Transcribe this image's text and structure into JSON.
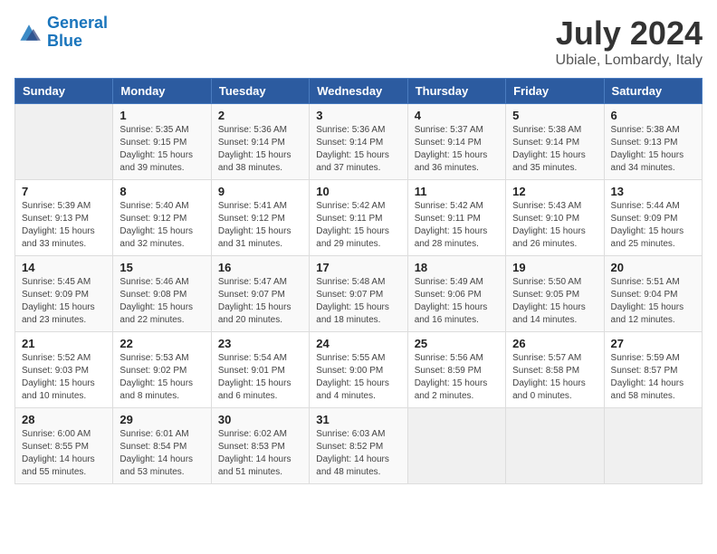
{
  "header": {
    "logo_line1": "General",
    "logo_line2": "Blue",
    "month_year": "July 2024",
    "location": "Ubiale, Lombardy, Italy"
  },
  "weekdays": [
    "Sunday",
    "Monday",
    "Tuesday",
    "Wednesday",
    "Thursday",
    "Friday",
    "Saturday"
  ],
  "weeks": [
    [
      {
        "day": "",
        "info": ""
      },
      {
        "day": "1",
        "info": "Sunrise: 5:35 AM\nSunset: 9:15 PM\nDaylight: 15 hours\nand 39 minutes."
      },
      {
        "day": "2",
        "info": "Sunrise: 5:36 AM\nSunset: 9:14 PM\nDaylight: 15 hours\nand 38 minutes."
      },
      {
        "day": "3",
        "info": "Sunrise: 5:36 AM\nSunset: 9:14 PM\nDaylight: 15 hours\nand 37 minutes."
      },
      {
        "day": "4",
        "info": "Sunrise: 5:37 AM\nSunset: 9:14 PM\nDaylight: 15 hours\nand 36 minutes."
      },
      {
        "day": "5",
        "info": "Sunrise: 5:38 AM\nSunset: 9:14 PM\nDaylight: 15 hours\nand 35 minutes."
      },
      {
        "day": "6",
        "info": "Sunrise: 5:38 AM\nSunset: 9:13 PM\nDaylight: 15 hours\nand 34 minutes."
      }
    ],
    [
      {
        "day": "7",
        "info": "Sunrise: 5:39 AM\nSunset: 9:13 PM\nDaylight: 15 hours\nand 33 minutes."
      },
      {
        "day": "8",
        "info": "Sunrise: 5:40 AM\nSunset: 9:12 PM\nDaylight: 15 hours\nand 32 minutes."
      },
      {
        "day": "9",
        "info": "Sunrise: 5:41 AM\nSunset: 9:12 PM\nDaylight: 15 hours\nand 31 minutes."
      },
      {
        "day": "10",
        "info": "Sunrise: 5:42 AM\nSunset: 9:11 PM\nDaylight: 15 hours\nand 29 minutes."
      },
      {
        "day": "11",
        "info": "Sunrise: 5:42 AM\nSunset: 9:11 PM\nDaylight: 15 hours\nand 28 minutes."
      },
      {
        "day": "12",
        "info": "Sunrise: 5:43 AM\nSunset: 9:10 PM\nDaylight: 15 hours\nand 26 minutes."
      },
      {
        "day": "13",
        "info": "Sunrise: 5:44 AM\nSunset: 9:09 PM\nDaylight: 15 hours\nand 25 minutes."
      }
    ],
    [
      {
        "day": "14",
        "info": "Sunrise: 5:45 AM\nSunset: 9:09 PM\nDaylight: 15 hours\nand 23 minutes."
      },
      {
        "day": "15",
        "info": "Sunrise: 5:46 AM\nSunset: 9:08 PM\nDaylight: 15 hours\nand 22 minutes."
      },
      {
        "day": "16",
        "info": "Sunrise: 5:47 AM\nSunset: 9:07 PM\nDaylight: 15 hours\nand 20 minutes."
      },
      {
        "day": "17",
        "info": "Sunrise: 5:48 AM\nSunset: 9:07 PM\nDaylight: 15 hours\nand 18 minutes."
      },
      {
        "day": "18",
        "info": "Sunrise: 5:49 AM\nSunset: 9:06 PM\nDaylight: 15 hours\nand 16 minutes."
      },
      {
        "day": "19",
        "info": "Sunrise: 5:50 AM\nSunset: 9:05 PM\nDaylight: 15 hours\nand 14 minutes."
      },
      {
        "day": "20",
        "info": "Sunrise: 5:51 AM\nSunset: 9:04 PM\nDaylight: 15 hours\nand 12 minutes."
      }
    ],
    [
      {
        "day": "21",
        "info": "Sunrise: 5:52 AM\nSunset: 9:03 PM\nDaylight: 15 hours\nand 10 minutes."
      },
      {
        "day": "22",
        "info": "Sunrise: 5:53 AM\nSunset: 9:02 PM\nDaylight: 15 hours\nand 8 minutes."
      },
      {
        "day": "23",
        "info": "Sunrise: 5:54 AM\nSunset: 9:01 PM\nDaylight: 15 hours\nand 6 minutes."
      },
      {
        "day": "24",
        "info": "Sunrise: 5:55 AM\nSunset: 9:00 PM\nDaylight: 15 hours\nand 4 minutes."
      },
      {
        "day": "25",
        "info": "Sunrise: 5:56 AM\nSunset: 8:59 PM\nDaylight: 15 hours\nand 2 minutes."
      },
      {
        "day": "26",
        "info": "Sunrise: 5:57 AM\nSunset: 8:58 PM\nDaylight: 15 hours\nand 0 minutes."
      },
      {
        "day": "27",
        "info": "Sunrise: 5:59 AM\nSunset: 8:57 PM\nDaylight: 14 hours\nand 58 minutes."
      }
    ],
    [
      {
        "day": "28",
        "info": "Sunrise: 6:00 AM\nSunset: 8:55 PM\nDaylight: 14 hours\nand 55 minutes."
      },
      {
        "day": "29",
        "info": "Sunrise: 6:01 AM\nSunset: 8:54 PM\nDaylight: 14 hours\nand 53 minutes."
      },
      {
        "day": "30",
        "info": "Sunrise: 6:02 AM\nSunset: 8:53 PM\nDaylight: 14 hours\nand 51 minutes."
      },
      {
        "day": "31",
        "info": "Sunrise: 6:03 AM\nSunset: 8:52 PM\nDaylight: 14 hours\nand 48 minutes."
      },
      {
        "day": "",
        "info": ""
      },
      {
        "day": "",
        "info": ""
      },
      {
        "day": "",
        "info": ""
      }
    ]
  ]
}
